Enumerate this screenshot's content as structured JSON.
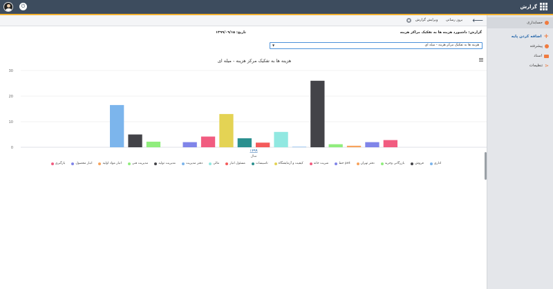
{
  "header": {
    "app_title": "گزارش",
    "app_icon": "apps-grid-icon",
    "logout_icon": "power-icon",
    "avatar_icon": "user-avatar-icon",
    "bar_color": "#3d4c5e",
    "accent_color": "#f3b12e"
  },
  "sidebar": {
    "items": [
      {
        "label": "حسابداری",
        "icon": "circle-icon",
        "active": true
      },
      {
        "label": "اضافه کردن پایه",
        "icon": "plus-icon",
        "primary": true
      },
      {
        "label": "پیشرفته",
        "icon": "circle-icon"
      },
      {
        "label": "اسناد",
        "icon": "folder-icon"
      },
      {
        "label": "تنظیمات",
        "icon": "share-icon"
      }
    ]
  },
  "toolbar": {
    "update_label": "بروز رسانی",
    "edit_label": "ویرایش گزارش",
    "back_icon": "back-arrow-icon",
    "settings_icon": "gear-icon"
  },
  "report": {
    "title": "گزارش: داشبورد هزینه ها به تفکیک مراکز هزینه",
    "date": "تاریخ: ۱۳۹۹/۰۹/۱۵"
  },
  "select": {
    "value": "هزینه ها به تفکیک مرکز هزینه - میله ای"
  },
  "chart_data": {
    "type": "bar",
    "title": "هزینه ها به تفکیک مرکز هزینه - میله ای",
    "xlabel": "سال",
    "categories": [
      "۱۳۹۹"
    ],
    "ylim": [
      0,
      30
    ],
    "yticks": [
      0,
      10,
      20,
      30
    ],
    "grid": true,
    "legend_position": "bottom",
    "series": [
      {
        "name": "اداری",
        "value": 16.5,
        "color": "#7cb5ec"
      },
      {
        "name": "فروش",
        "value": 5.0,
        "color": "#434348"
      },
      {
        "name": "بازرگانی وخرید",
        "value": 2.2,
        "color": "#90ed7d"
      },
      {
        "name": "دفتر تهران",
        "value": 0,
        "color": "#f7a35c"
      },
      {
        "name": "pet خط",
        "value": 2.0,
        "color": "#8085e9"
      },
      {
        "name": "شربت خانه",
        "value": 4.2,
        "color": "#f15c80"
      },
      {
        "name": "کیفیت و آزمایشگاه",
        "value": 13.0,
        "color": "#e4d354"
      },
      {
        "name": "تاسیسات",
        "value": 3.5,
        "color": "#2b908f"
      },
      {
        "name": "مسئول انبار",
        "value": 1.8,
        "color": "#f45b5b"
      },
      {
        "name": "مالی",
        "value": 6.0,
        "color": "#91e8e1"
      },
      {
        "name": "دفتر مدیریت",
        "value": 0.2,
        "color": "#7cb5ec"
      },
      {
        "name": "مدیریت تولید",
        "value": 26.0,
        "color": "#434348"
      },
      {
        "name": "مدیریت فنی",
        "value": 1.2,
        "color": "#90ed7d"
      },
      {
        "name": "انبار مواد اولیه",
        "value": 0.6,
        "color": "#f7a35c"
      },
      {
        "name": "انبار محصول",
        "value": 2.0,
        "color": "#8085e9"
      },
      {
        "name": "بازگیری",
        "value": 2.8,
        "color": "#f15c80"
      }
    ]
  }
}
